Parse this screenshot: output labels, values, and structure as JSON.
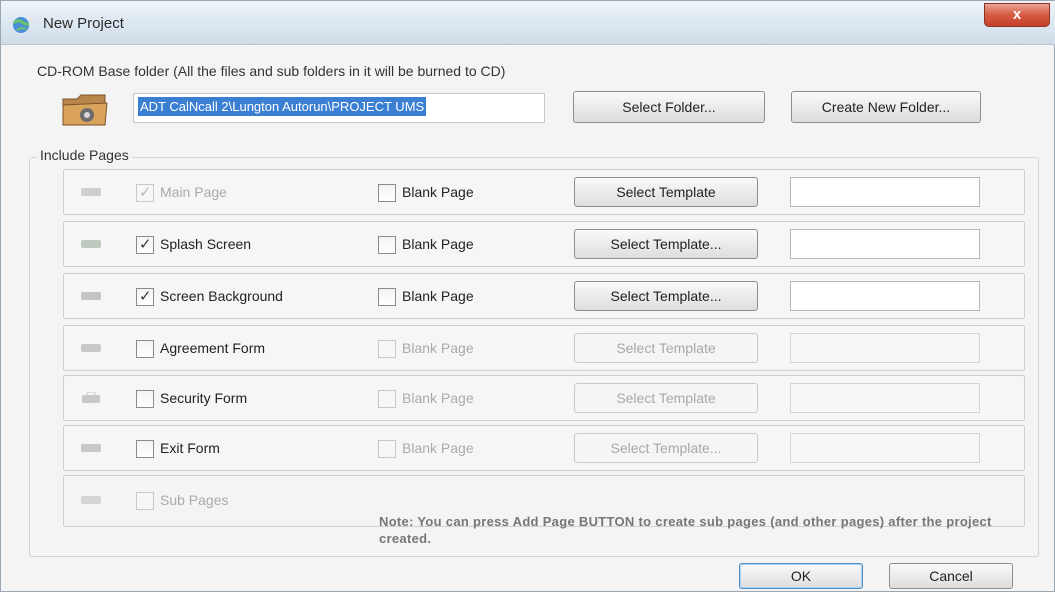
{
  "window": {
    "title": "New Project",
    "close_symbol": "x",
    "close_icon": "close-icon",
    "app_icon": "globe-icon"
  },
  "header": {
    "label": "CD-ROM Base folder (All the files and sub folders in it will be burned to CD)",
    "folder_icon": "folder-icon",
    "path_value": "ADT CalNcall 2\\Lungton Autorun\\PROJECT UMS",
    "select_folder_label": "Select Folder...",
    "create_folder_label": "Create New Folder..."
  },
  "include": {
    "label": "Include Pages",
    "rows": [
      {
        "label": "Main Page",
        "checked": true,
        "enabled": false,
        "blank_label": "Blank Page",
        "template_label": "Select Template",
        "template_enabled": true,
        "field_enabled": true
      },
      {
        "label": "Splash Screen",
        "checked": true,
        "enabled": true,
        "blank_label": "Blank Page",
        "template_label": "Select Template...",
        "template_enabled": true,
        "field_enabled": true
      },
      {
        "label": "Screen Background",
        "checked": true,
        "enabled": true,
        "blank_label": "Blank Page",
        "template_label": "Select Template...",
        "template_enabled": true,
        "field_enabled": true
      },
      {
        "label": "Agreement Form",
        "checked": false,
        "enabled": true,
        "blank_label": "Blank Page",
        "template_label": "Select Template",
        "template_enabled": false,
        "field_enabled": false
      },
      {
        "label": "Security Form",
        "checked": false,
        "enabled": true,
        "blank_label": "Blank Page",
        "template_label": "Select Template",
        "template_enabled": false,
        "field_enabled": false
      },
      {
        "label": "Exit Form",
        "checked": false,
        "enabled": true,
        "blank_label": "Blank Page",
        "template_label": "Select Template...",
        "template_enabled": false,
        "field_enabled": false
      }
    ],
    "sub_pages": {
      "label": "Sub Pages",
      "checked": false,
      "enabled": false,
      "note": "Note: You can press Add Page BUTTON to create sub pages (and other pages) after the project created."
    }
  },
  "footer": {
    "ok_label": "OK",
    "cancel_label": "Cancel"
  },
  "colors": {
    "selection": "#3b7fd3",
    "close_button": "#d65b42",
    "disabled_text": "#aaaaaa"
  }
}
